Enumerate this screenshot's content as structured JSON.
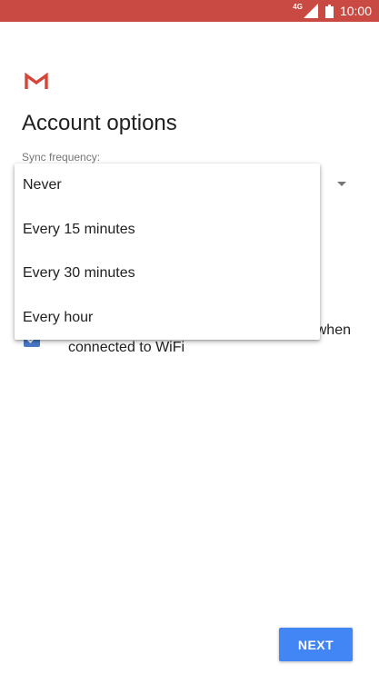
{
  "status_bar": {
    "network": "4G",
    "time": "10:00",
    "icons": [
      "signal-icon",
      "battery-icon"
    ],
    "background": "#c94a43"
  },
  "app": {
    "logo": "gmail-logo",
    "logo_color": "#d44638"
  },
  "page": {
    "title": "Account options",
    "sync_label": "Sync frequency:"
  },
  "sync_menu": {
    "items": [
      "Never",
      "Every 15 minutes",
      "Every 30 minutes",
      "Every hour"
    ]
  },
  "wifi_option": {
    "label_line1": "when",
    "label_line2": "connected to WiFi",
    "checked": true,
    "checkbox_color": "#4a79c7"
  },
  "footer": {
    "next_label": "NEXT",
    "next_color": "#4285f4"
  }
}
